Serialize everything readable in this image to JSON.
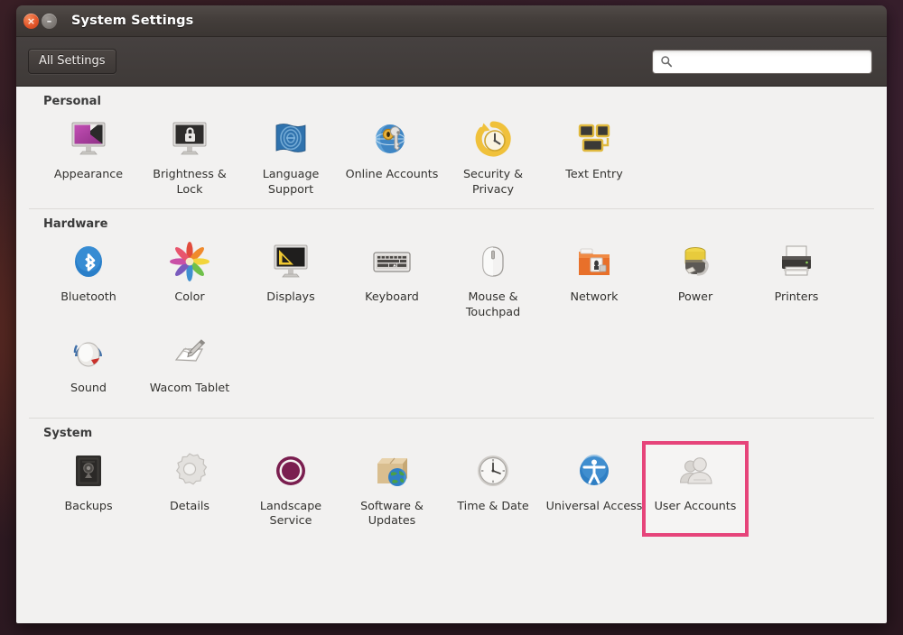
{
  "window": {
    "title": "System Settings",
    "close_label": "×",
    "minimize_label": "–"
  },
  "toolbar": {
    "all_settings_label": "All Settings",
    "search_value": "",
    "search_placeholder": ""
  },
  "highlight": {
    "color": "#e6447a",
    "target": "User Accounts"
  },
  "sections": [
    {
      "title": "Personal",
      "items": [
        {
          "label": "Appearance",
          "icon": "appearance-icon"
        },
        {
          "label": "Brightness & Lock",
          "icon": "brightness-lock-icon"
        },
        {
          "label": "Language Support",
          "icon": "language-support-icon"
        },
        {
          "label": "Online Accounts",
          "icon": "online-accounts-icon"
        },
        {
          "label": "Security & Privacy",
          "icon": "security-privacy-icon"
        },
        {
          "label": "Text Entry",
          "icon": "text-entry-icon"
        }
      ]
    },
    {
      "title": "Hardware",
      "items": [
        {
          "label": "Bluetooth",
          "icon": "bluetooth-icon"
        },
        {
          "label": "Color",
          "icon": "color-icon"
        },
        {
          "label": "Displays",
          "icon": "displays-icon"
        },
        {
          "label": "Keyboard",
          "icon": "keyboard-icon"
        },
        {
          "label": "Mouse & Touchpad",
          "icon": "mouse-touchpad-icon"
        },
        {
          "label": "Network",
          "icon": "network-icon"
        },
        {
          "label": "Power",
          "icon": "power-icon"
        },
        {
          "label": "Printers",
          "icon": "printers-icon"
        },
        {
          "label": "Sound",
          "icon": "sound-icon"
        },
        {
          "label": "Wacom Tablet",
          "icon": "wacom-tablet-icon"
        }
      ]
    },
    {
      "title": "System",
      "items": [
        {
          "label": "Backups",
          "icon": "backups-icon"
        },
        {
          "label": "Details",
          "icon": "details-icon"
        },
        {
          "label": "Landscape Service",
          "icon": "landscape-service-icon"
        },
        {
          "label": "Software & Updates",
          "icon": "software-updates-icon"
        },
        {
          "label": "Time & Date",
          "icon": "time-date-icon"
        },
        {
          "label": "Universal Access",
          "icon": "universal-access-icon"
        },
        {
          "label": "User Accounts",
          "icon": "user-accounts-icon",
          "highlighted": true
        }
      ]
    }
  ]
}
